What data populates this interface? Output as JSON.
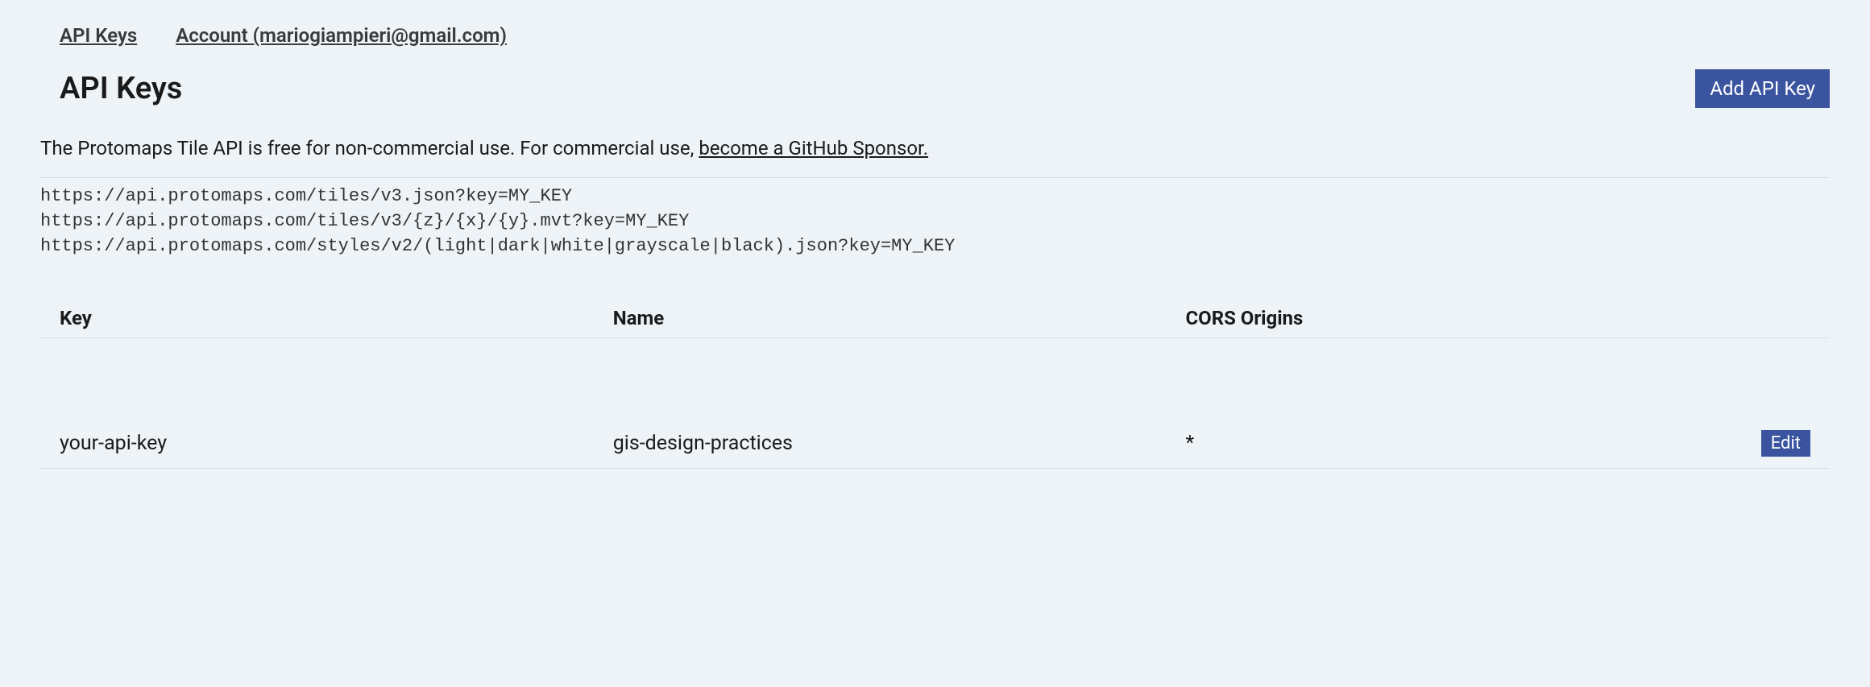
{
  "nav": {
    "api_keys": "API Keys",
    "account": "Account (mariogiampieri@gmail.com)"
  },
  "header": {
    "title": "API Keys",
    "add_button": "Add API Key"
  },
  "description": {
    "prefix": "The Protomaps Tile API is free for non-commercial use. For commercial use, ",
    "link": "become a GitHub Sponsor."
  },
  "code_lines": [
    "https://api.protomaps.com/tiles/v3.json?key=MY_KEY",
    "https://api.protomaps.com/tiles/v3/{z}/{x}/{y}.mvt?key=MY_KEY",
    "https://api.protomaps.com/styles/v2/(light|dark|white|grayscale|black).json?key=MY_KEY"
  ],
  "table": {
    "headers": {
      "key": "Key",
      "name": "Name",
      "cors": "CORS Origins"
    },
    "rows": [
      {
        "key": "your-api-key",
        "name": "gis-design-practices",
        "cors": "*",
        "edit": "Edit"
      }
    ]
  }
}
